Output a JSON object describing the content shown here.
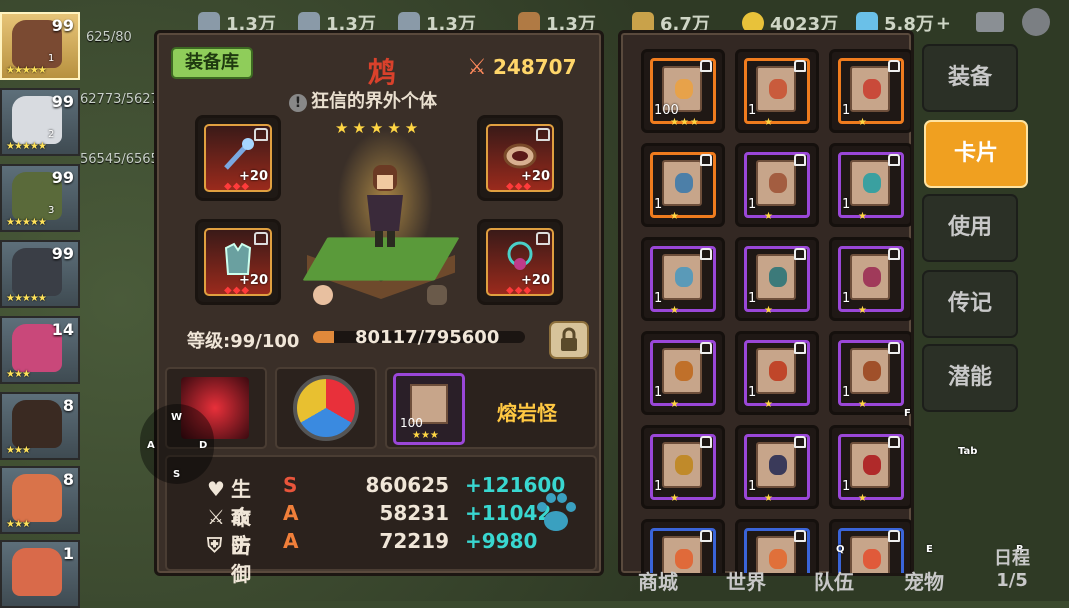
{
  "topbar": {
    "resources": [
      "1.3万",
      "1.3万",
      "1.3万",
      "1.3万",
      "6.7万",
      "4023万",
      "5.8万"
    ],
    "plus": "+"
  },
  "heroes": [
    {
      "level": "99",
      "stars": "★★★★★",
      "num": "1",
      "hp": "625/80",
      "selected": true
    },
    {
      "level": "99",
      "stars": "★★★★★",
      "num": "2",
      "hp": "62773/5627"
    },
    {
      "level": "99",
      "stars": "★★★★★",
      "num": "3",
      "hp": "56545/6565"
    },
    {
      "level": "99",
      "stars": "★★★★★",
      "num": "",
      "hp": ""
    },
    {
      "level": "14",
      "stars": "★★★",
      "num": "",
      "hp": ""
    },
    {
      "level": "8",
      "stars": "★★★",
      "num": "",
      "hp": ""
    },
    {
      "level": "8",
      "stars": "★★★",
      "num": "",
      "hp": ""
    },
    {
      "level": "1",
      "stars": "★★★",
      "num": "",
      "hp": ""
    }
  ],
  "panel": {
    "tag": "装备库",
    "hero_name": "鸩",
    "power": "248707",
    "title": "狂信的界外个体",
    "stars": "★★★★★",
    "level_label": "等级:99/100",
    "exp_text": "80117/795600",
    "exp_fraction": 0.1,
    "equipment": [
      {
        "name": "staff",
        "plus": "+20"
      },
      {
        "name": "ring",
        "plus": "+20"
      },
      {
        "name": "armor",
        "plus": "+20"
      },
      {
        "name": "amulet",
        "plus": "+20"
      }
    ],
    "card_slot": {
      "count": "100",
      "stars": "★★★",
      "name": "熔岩怪"
    },
    "stats": [
      {
        "name": "生命",
        "grade": "S",
        "value": "860625",
        "bonus": "+121600",
        "grade_color": "#e8553b"
      },
      {
        "name": "攻击",
        "grade": "A",
        "value": "58231",
        "bonus": "+11042",
        "grade_color": "#f07f3a"
      },
      {
        "name": "防御",
        "grade": "A",
        "value": "72219",
        "bonus": "+9980",
        "grade_color": "#f07f3a"
      }
    ]
  },
  "cards": [
    {
      "count": "100",
      "stars": "★★★",
      "frame": "#f07c1e",
      "pic": "#e7a24a"
    },
    {
      "count": "1",
      "stars": "★",
      "frame": "#f07c1e",
      "pic": "#c95b3c"
    },
    {
      "count": "1",
      "stars": "★",
      "frame": "#f07c1e",
      "pic": "#c94a3a"
    },
    {
      "count": "1",
      "stars": "★",
      "frame": "#f07c1e",
      "pic": "#4c7fa8"
    },
    {
      "count": "1",
      "stars": "★",
      "frame": "#9a47d8",
      "pic": "#a35d40"
    },
    {
      "count": "1",
      "stars": "★",
      "frame": "#9a47d8",
      "pic": "#3aa0a0"
    },
    {
      "count": "1",
      "stars": "★",
      "frame": "#9a47d8",
      "pic": "#5a9ab8"
    },
    {
      "count": "1",
      "stars": "★",
      "frame": "#9a47d8",
      "pic": "#3c7a7a"
    },
    {
      "count": "1",
      "stars": "★",
      "frame": "#9a47d8",
      "pic": "#a03a5a"
    },
    {
      "count": "1",
      "stars": "★",
      "frame": "#9a47d8",
      "pic": "#c0702a"
    },
    {
      "count": "1",
      "stars": "★",
      "frame": "#9a47d8",
      "pic": "#c0462a"
    },
    {
      "count": "1",
      "stars": "★",
      "frame": "#9a47d8",
      "pic": "#a0502a"
    },
    {
      "count": "1",
      "stars": "★",
      "frame": "#9a47d8",
      "pic": "#c08a2a"
    },
    {
      "count": "1",
      "stars": "★",
      "frame": "#9a47d8",
      "pic": "#3a3a5a"
    },
    {
      "count": "1",
      "stars": "★",
      "frame": "#9a47d8",
      "pic": "#b02a2a"
    },
    {
      "count": "",
      "stars": "",
      "frame": "#3a64d8",
      "pic": "#e06a3a"
    },
    {
      "count": "",
      "stars": "",
      "frame": "#3a64d8",
      "pic": "#e0703a"
    },
    {
      "count": "",
      "stars": "",
      "frame": "#3a64d8",
      "pic": "#e05a3a"
    }
  ],
  "tabs": [
    "装备",
    "卡片",
    "使用",
    "传记",
    "潜能"
  ],
  "active_tab": "卡片",
  "keys": {
    "w": "W",
    "a": "A",
    "s": "S",
    "d": "D",
    "f": "F",
    "tab": "Tab",
    "q": "Q",
    "e": "E",
    "r": "R"
  },
  "bottom": {
    "shop": "商城",
    "world": "世界",
    "team": "队伍",
    "pet": "宠物",
    "day": "日程",
    "day_page": "1/5"
  }
}
